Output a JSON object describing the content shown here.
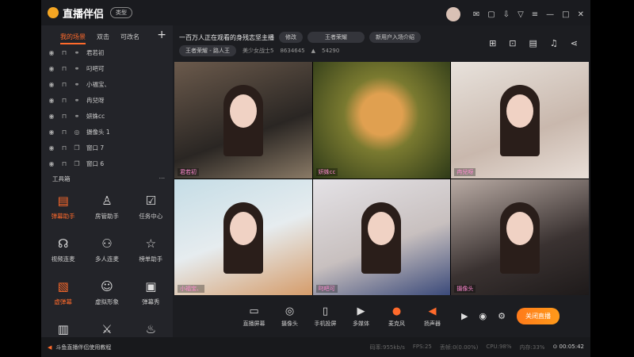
{
  "app": {
    "title": "直播伴侣",
    "type_button": "类型"
  },
  "scene_tabs": [
    "我的场景",
    "双击",
    "可改名"
  ],
  "scenes": [
    {
      "icon": "link-icon",
      "name": "君若初"
    },
    {
      "icon": "link-icon",
      "name": "叼吧可"
    },
    {
      "icon": "link-icon",
      "name": "小福宝、"
    },
    {
      "icon": "link-icon",
      "name": "冉兒呀"
    },
    {
      "icon": "link-icon",
      "name": "妍姝cc"
    },
    {
      "icon": "camera-icon",
      "name": "摄像头 1"
    },
    {
      "icon": "window-icon",
      "name": "窗口 7"
    },
    {
      "icon": "window-icon",
      "name": "窗口 6"
    }
  ],
  "toolbox": {
    "title": "工具箱",
    "tools": [
      {
        "label": "弹幕助手",
        "active": true,
        "icon": "▤"
      },
      {
        "label": "房管助手",
        "active": false,
        "icon": "♙"
      },
      {
        "label": "任务中心",
        "active": false,
        "icon": "☑"
      },
      {
        "label": "视频连麦",
        "active": false,
        "icon": "☊"
      },
      {
        "label": "多人连麦",
        "active": false,
        "icon": "⚇"
      },
      {
        "label": "榜单助手",
        "active": false,
        "icon": "☆"
      },
      {
        "label": "虚弹幕",
        "active": true,
        "icon": "▧"
      },
      {
        "label": "虚拟形象",
        "active": false,
        "icon": "☺"
      },
      {
        "label": "弹幕秀",
        "active": false,
        "icon": "▣"
      },
      {
        "label": "",
        "active": false,
        "icon": "▥"
      },
      {
        "label": "",
        "active": false,
        "icon": "⚔"
      },
      {
        "label": "",
        "active": false,
        "icon": "♨"
      }
    ]
  },
  "room": {
    "title": "一百万人正在观看的身残志坚主播",
    "edit": "修改",
    "category": "王者荣耀",
    "intro": "新用户入场介绍",
    "sub_category": "王者荣耀 - 路人王",
    "anchor": "美少女战士5",
    "room_id": "8634645",
    "heat": "54290"
  },
  "tiles": [
    {
      "name": "君若初"
    },
    {
      "name": "妍姝cc"
    },
    {
      "name": "冉兒呀"
    },
    {
      "name": "小福宝、"
    },
    {
      "name": "叼吧可"
    },
    {
      "name": "摄像头"
    }
  ],
  "bottom": {
    "buttons": [
      "直播屏幕",
      "摄像头",
      "手机投屏",
      "多媒体",
      "麦克风",
      "扬声器"
    ],
    "close_live": "关闭直播"
  },
  "status": {
    "tutorial": "斗鱼直播伴侣使用教程",
    "bitrate": "码率:955kb/s",
    "fps": "FPS:25",
    "drop": "丢帧:0(0.00%)",
    "cpu": "CPU:98%",
    "memory": "内存:33%",
    "time": "00:05:42"
  }
}
